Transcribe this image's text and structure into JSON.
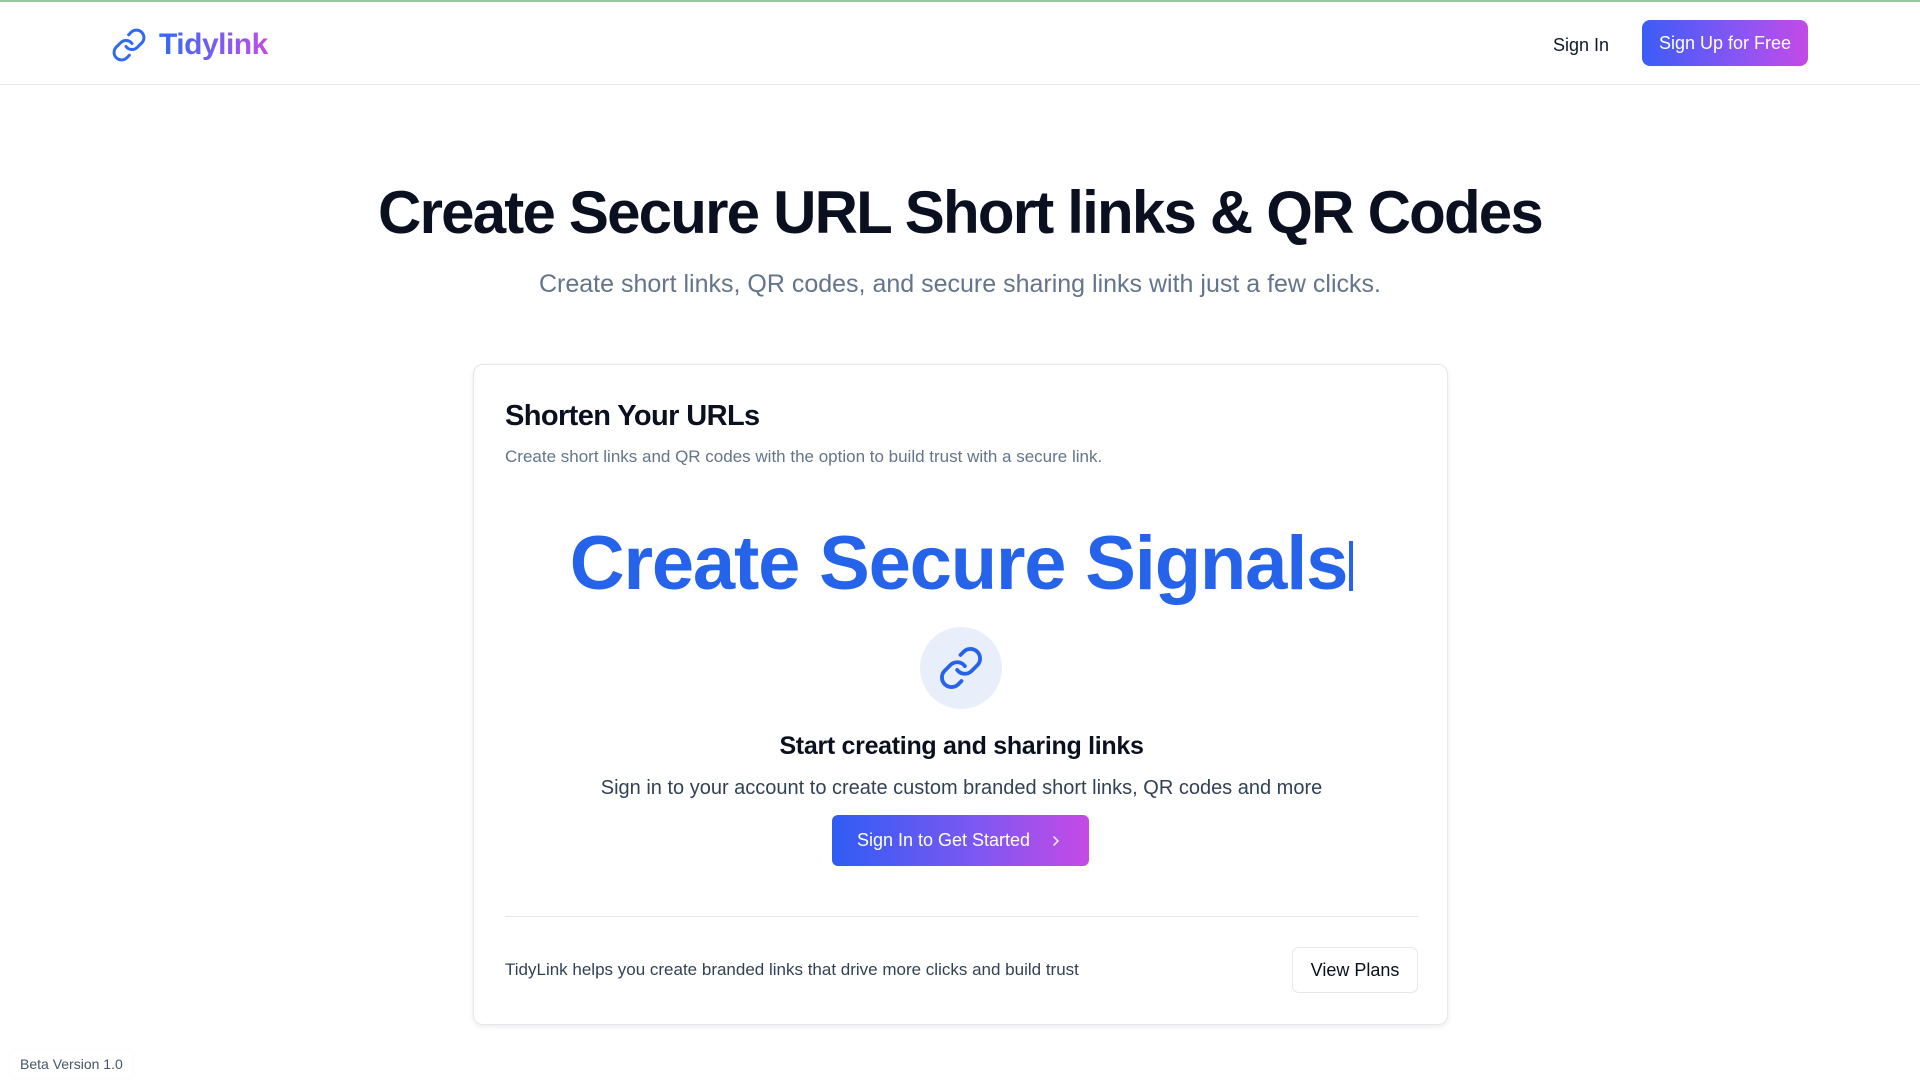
{
  "brand": {
    "name": "Tidylink",
    "logo_icon": "link-icon",
    "gradient_colors": [
      "#2f6bf0",
      "#7c5cf0",
      "#c14de6"
    ]
  },
  "nav": {
    "sign_in_label": "Sign In",
    "sign_up_label": "Sign Up for Free"
  },
  "hero": {
    "title": "Create Secure URL Short links & QR Codes",
    "subtitle": "Create short links, QR codes, and secure sharing links with just a few clicks."
  },
  "card": {
    "title": "Shorten Your URLs",
    "description": "Create short links and QR codes with the option to build trust with a secure link.",
    "typing_text": "Create Secure Signals",
    "typing_color": "#2563eb",
    "empty_state_icon": "link-icon",
    "empty_title": "Start creating and sharing links",
    "empty_description": "Sign in to your account to create custom branded short links, QR codes and more",
    "cta_label": "Sign In to Get Started",
    "cta_icon": "chevron-right-icon",
    "footer_text": "TidyLink helps you create branded links that drive more clicks and build trust",
    "view_plans_label": "View Plans"
  },
  "beta_label": "Beta Version 1.0"
}
